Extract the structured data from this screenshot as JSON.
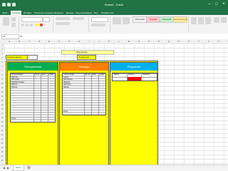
{
  "window": {
    "title": "Книга1 - Excel",
    "titlebar_color": "#217346"
  },
  "menu": {
    "tabs": [
      "Файл",
      "Главная",
      "Вставка",
      "Разметка страницы",
      "Формулы",
      "Данные",
      "Рецензирование",
      "Вид",
      "Разработчик"
    ]
  },
  "ribbon": {
    "styles": [
      {
        "label": "Обычный",
        "color": "#ffffff"
      },
      {
        "label": "Плохой",
        "color": "#ffc7ce"
      },
      {
        "label": "Хороший",
        "color": "#c6efce"
      },
      {
        "label": "Нейтральный",
        "color": "#ffeb9c"
      }
    ]
  },
  "formula_bar": {
    "name_box": "A1",
    "fx": "fx"
  },
  "columns": [
    "A",
    "B",
    "C",
    "D",
    "E",
    "F",
    "G",
    "H",
    "I",
    "J",
    "K",
    "L",
    "M",
    "N",
    "O",
    "P",
    "Q",
    "R",
    "S",
    "T",
    "U",
    "V",
    "W"
  ],
  "sheet": {
    "plan_label": "План выпуска",
    "input1_label": "Наименование",
    "input1_value": "1",
    "input2_label": "Продукция",
    "panels": [
      {
        "title": "Поступления",
        "color": "#00b050"
      },
      {
        "title": "Расходы",
        "color": "#ff7f00"
      },
      {
        "title": "Результат",
        "color": "#00b0f0"
      }
    ],
    "table1": {
      "headers": [
        "Наименование",
        "Кол-во",
        "Цена",
        "Сумма"
      ],
      "rows": [
        [
          "Изделие",
          "1",
          "0",
          "0"
        ],
        [
          "Материал",
          "0",
          "0",
          "0"
        ],
        [
          "Комплектующие",
          "0",
          "0",
          "0"
        ],
        [
          "Работа",
          "0",
          "0",
          "0"
        ],
        [
          "Прочее",
          "0",
          "0",
          "0"
        ]
      ],
      "total_label": "Итого"
    },
    "table2": {
      "headers": [
        "Статья затрат",
        "Кол-во",
        "Цена",
        "Сумма"
      ],
      "rows": [
        [
          "Сырьё",
          "0",
          "0",
          "0"
        ],
        [
          "Материалы",
          "0",
          "0",
          "0"
        ],
        [
          "Энергия",
          "0",
          "0",
          "0"
        ],
        [
          "Зарплата",
          "0",
          "0",
          "0"
        ],
        [
          "Налоги",
          "0",
          "0",
          "0"
        ]
      ],
      "total_label": "Итого"
    },
    "table3": {
      "headers": [
        "Доход",
        "Расход",
        "Прибыль"
      ],
      "highlight_color": "#ff0000"
    }
  },
  "sheet_tabs": [
    "Лист1"
  ]
}
